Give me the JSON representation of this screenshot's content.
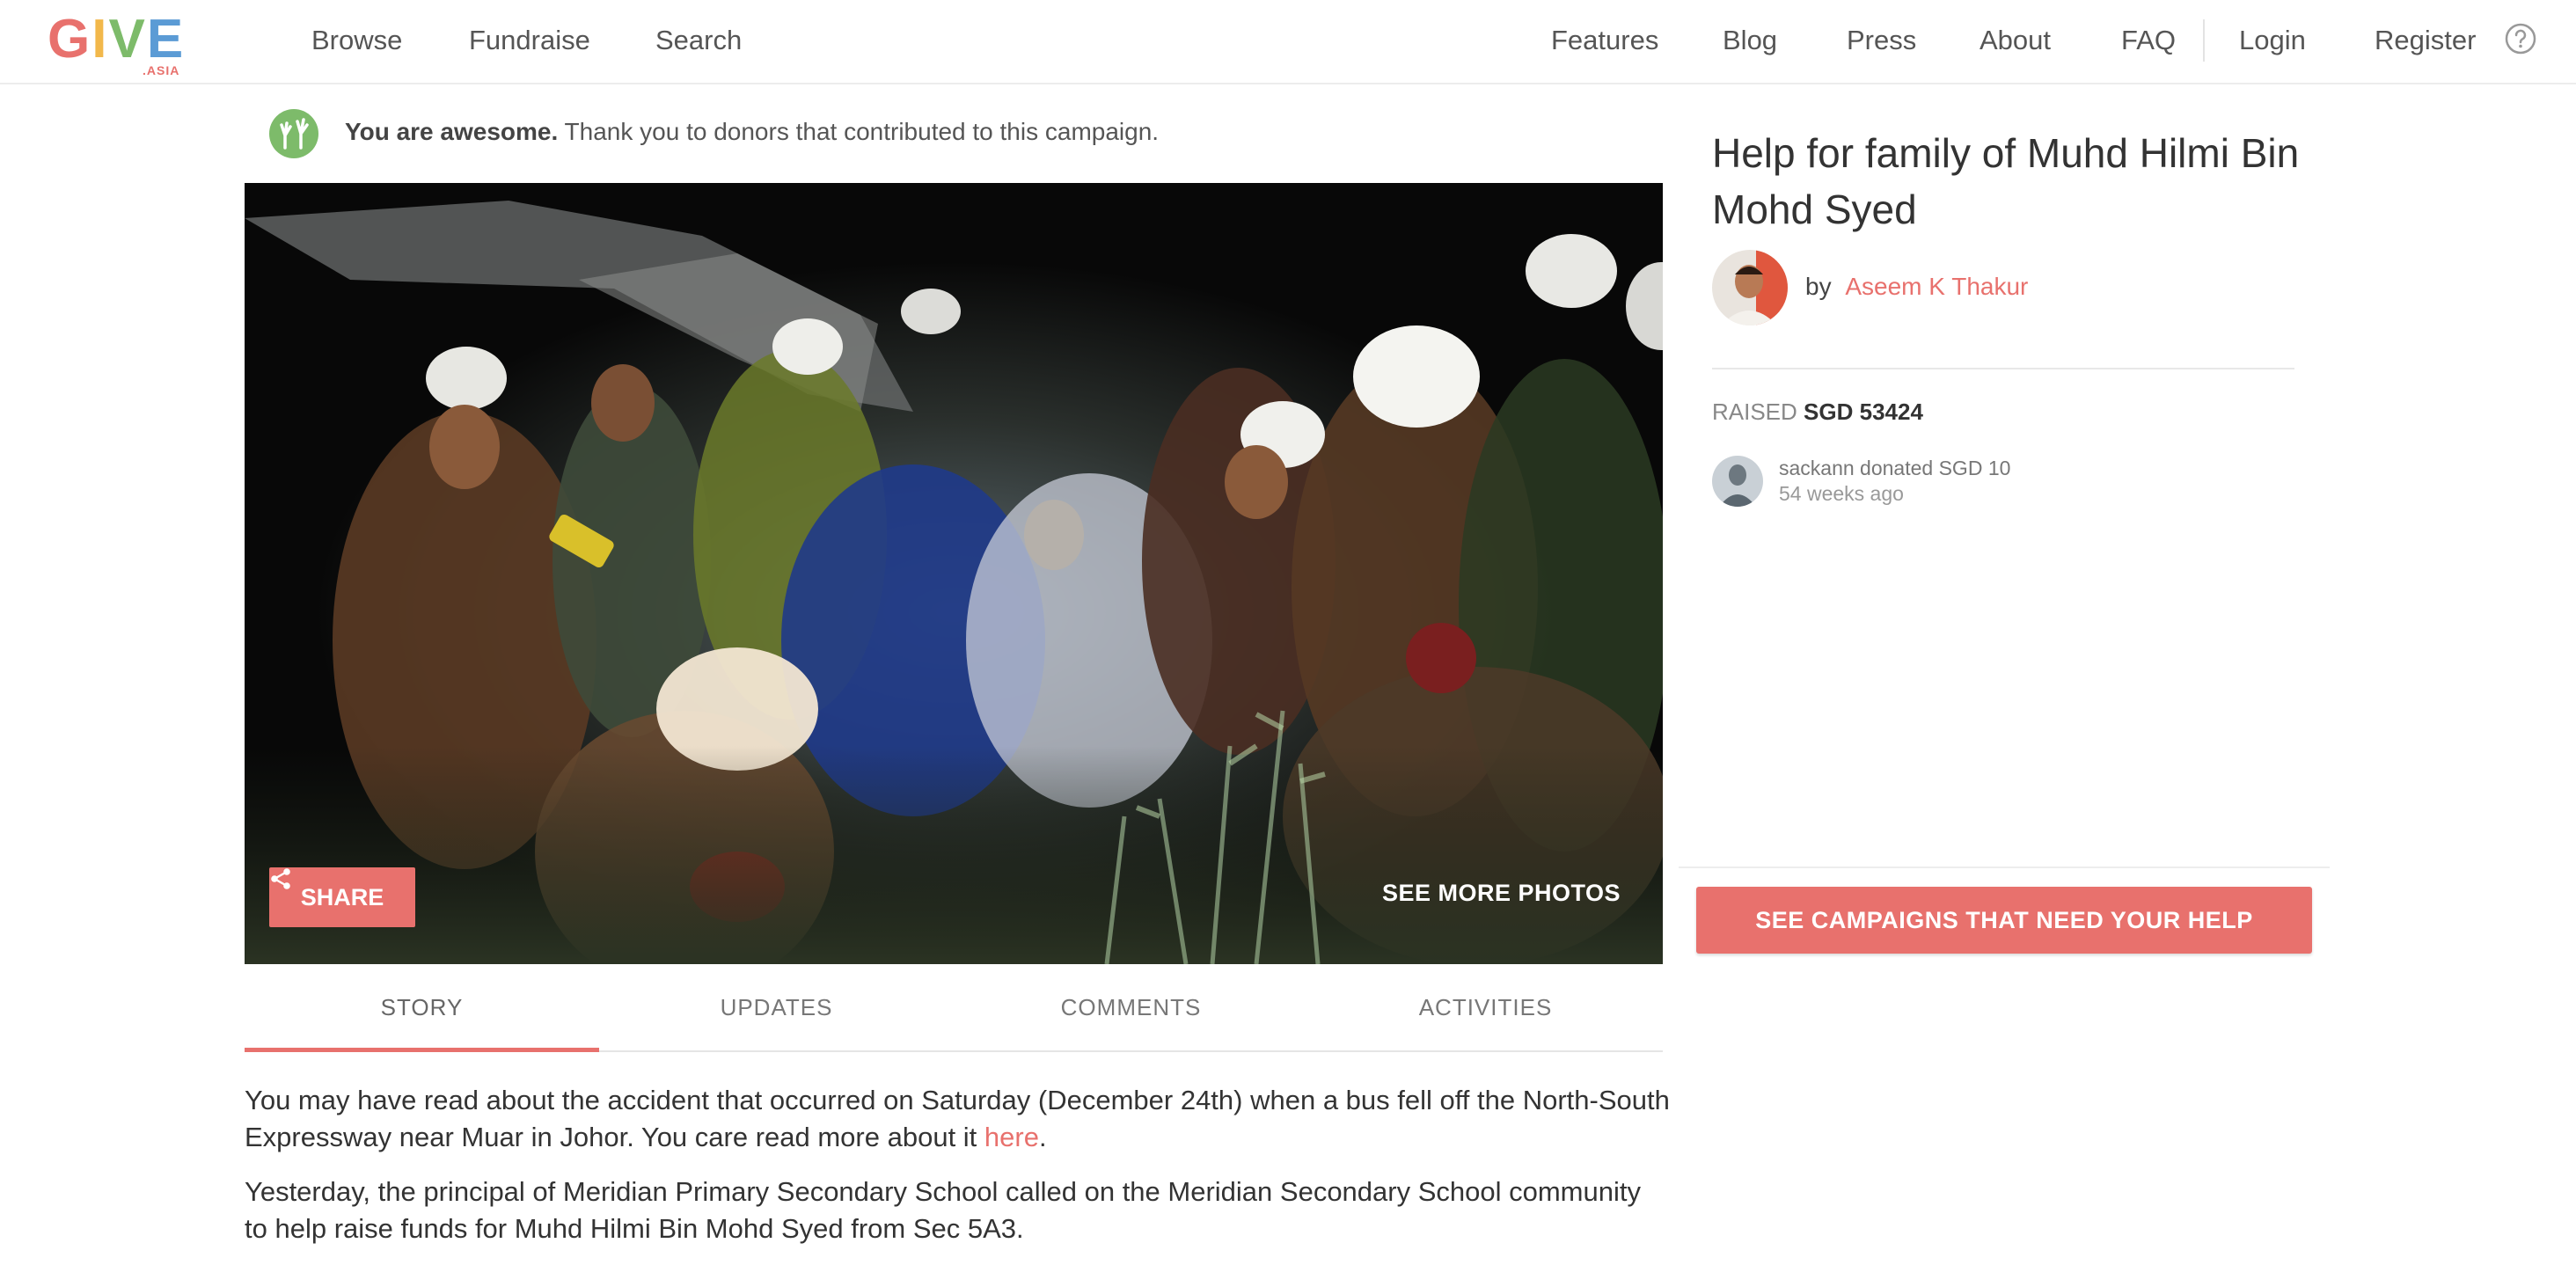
{
  "brand": {
    "logo_text": "GIVE",
    "logo_suffix": ".ASIA",
    "accent_color": "#e8716d"
  },
  "nav": {
    "left": [
      "Browse",
      "Fundraise",
      "Search"
    ],
    "right": [
      "Features",
      "Blog",
      "Press",
      "About",
      "FAQ"
    ],
    "login": "Login",
    "register": "Register",
    "help_icon": "question-circle-icon"
  },
  "thanks": {
    "icon": "raised-hands-icon",
    "bold": "You are awesome.",
    "text": "Thank you to donors that contributed to this campaign."
  },
  "hero": {
    "share_label": "SHARE",
    "share_icon": "share-icon",
    "see_more_label": "SEE MORE PHOTOS"
  },
  "tabs": [
    "STORY",
    "UPDATES",
    "COMMENTS",
    "ACTIVITIES"
  ],
  "active_tab": "STORY",
  "story": {
    "p1_before": "You may have read about the accident that occurred on Saturday (December 24th) when a bus fell off the North-South Expressway near Muar in Johor. You care read more about it",
    "p1_link": "here",
    "p1_after": ".",
    "p2": "Yesterday, the principal of Meridian Primary Secondary School called on the Meridian Secondary School community to help raise funds for Muhd Hilmi Bin Mohd Syed from Sec 5A3."
  },
  "campaign": {
    "title": "Help for family of Muhd Hilmi Bin Mohd Syed",
    "by_label": "by",
    "organizer": "Aseem K Thakur",
    "raised_label": "RAISED",
    "raised_amount": "SGD 53424"
  },
  "donation": {
    "text": "sackann donated SGD 10",
    "time": "54 weeks ago"
  },
  "cta_label": "SEE CAMPAIGNS THAT NEED YOUR HELP"
}
